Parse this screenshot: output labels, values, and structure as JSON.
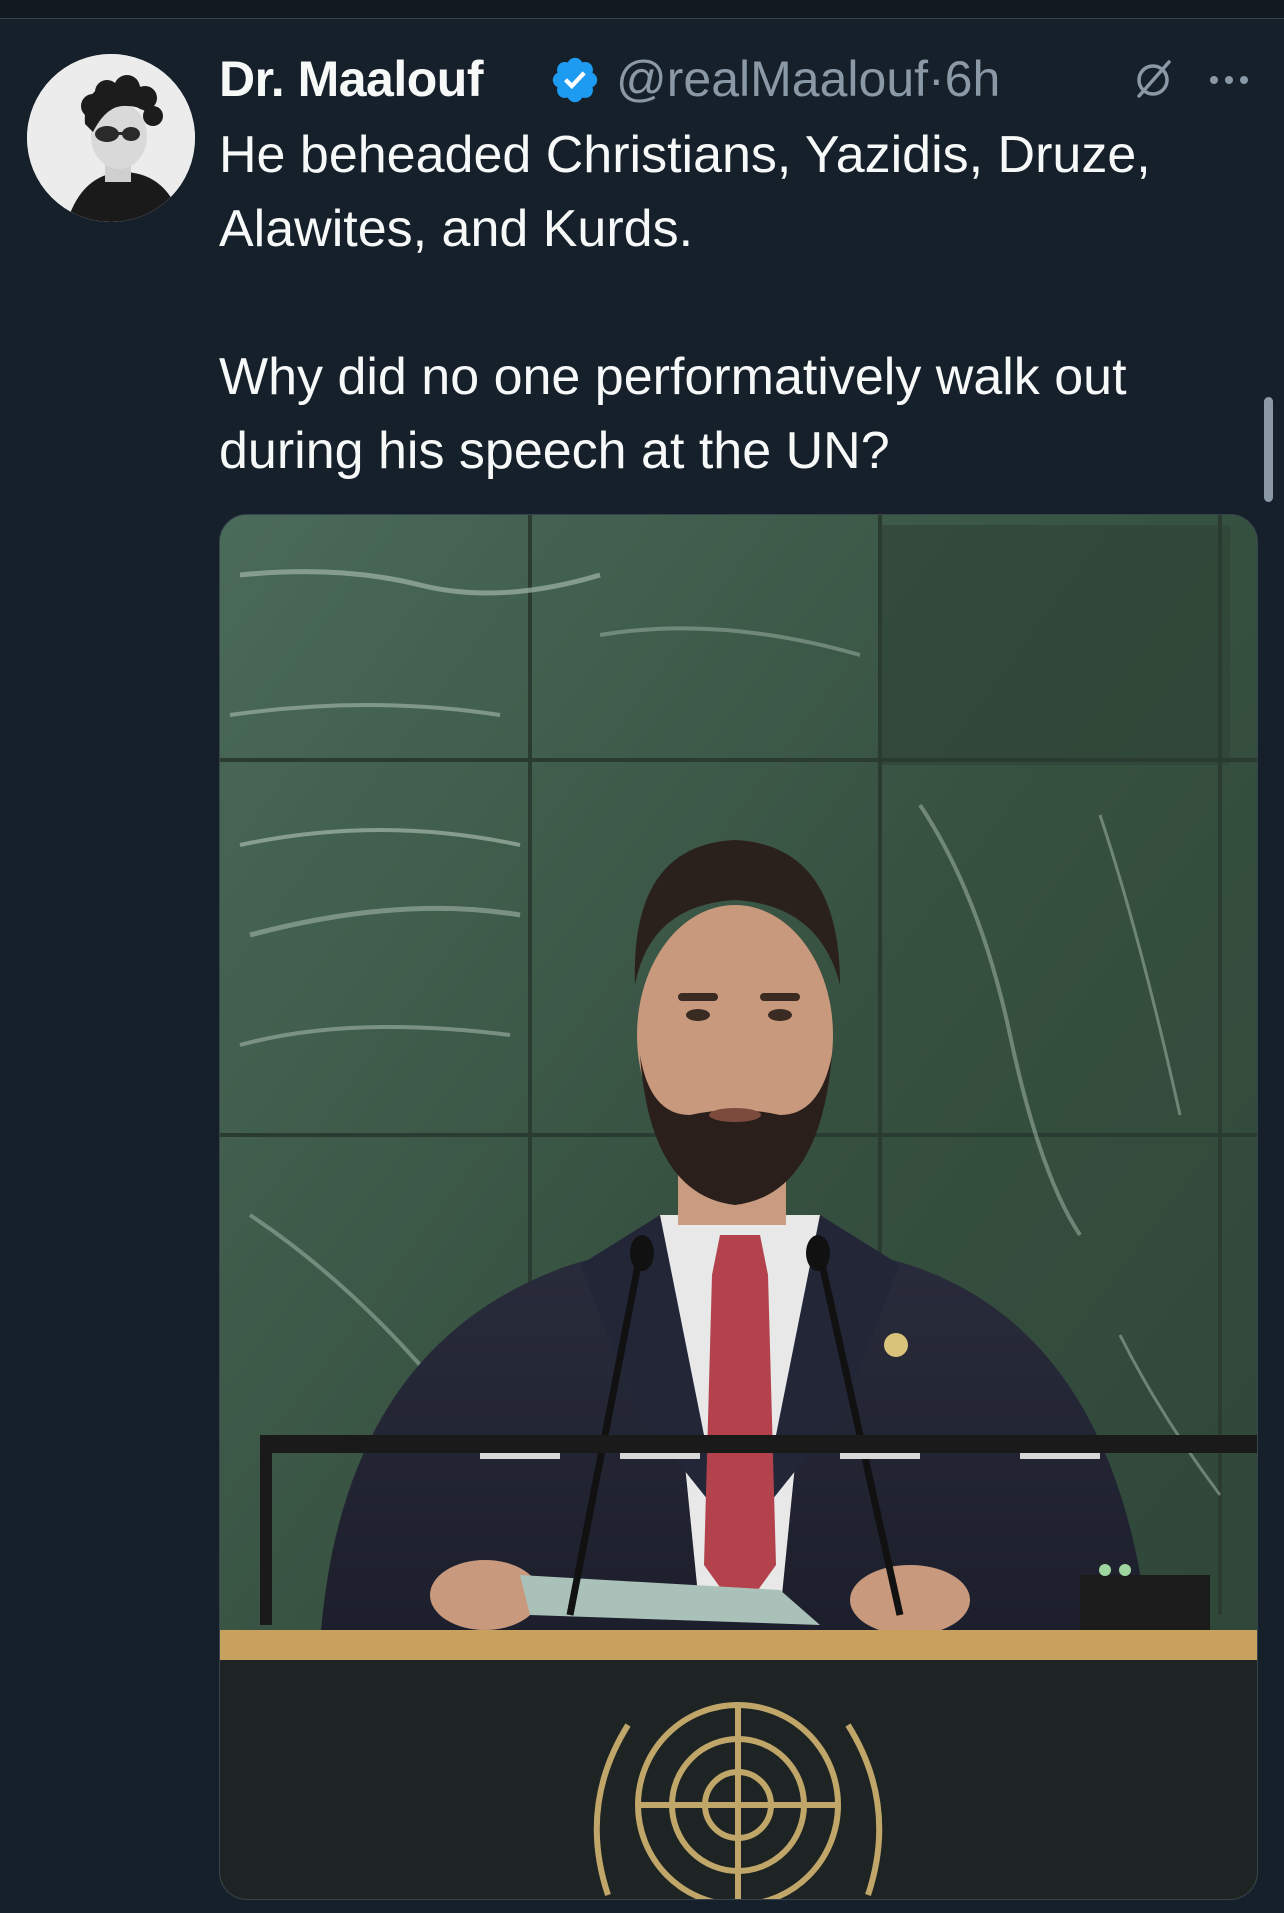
{
  "tweet": {
    "author": {
      "display_name": "Dr. Maalouf",
      "verified": true,
      "handle": "@realMaalouf",
      "separator": "·",
      "time": "6h"
    },
    "text": "He beheaded Christians, Yazidis, Druze, Alawites, and Kurds.\n\nWhy did no one performatively walk out during his speech at the UN?",
    "icons": {
      "verified": "verified-badge-icon",
      "grok": "grok-icon",
      "more": "more-options-icon"
    }
  },
  "colors": {
    "background": "#15202b",
    "text_primary": "#f7f9f9",
    "text_secondary": "#8b98a5",
    "verified_blue": "#1d9bf0"
  }
}
